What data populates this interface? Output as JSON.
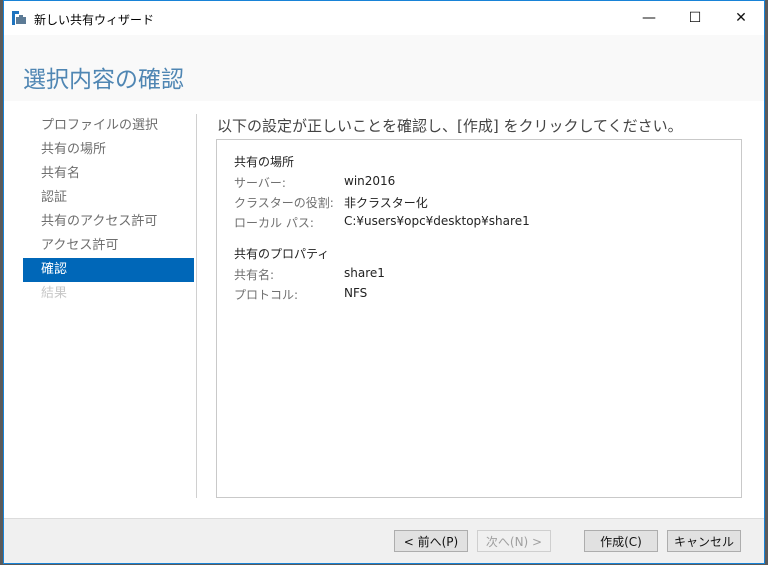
{
  "window": {
    "title": "新しい共有ウィザード",
    "minimize": "—",
    "maximize": "☐",
    "close": "✕"
  },
  "page_title": "選択内容の確認",
  "nav": [
    {
      "label": "プロファイルの選択",
      "state": "normal"
    },
    {
      "label": "共有の場所",
      "state": "normal"
    },
    {
      "label": "共有名",
      "state": "normal"
    },
    {
      "label": "認証",
      "state": "normal"
    },
    {
      "label": "共有のアクセス許可",
      "state": "normal"
    },
    {
      "label": "アクセス許可",
      "state": "normal"
    },
    {
      "label": "確認",
      "state": "selected"
    },
    {
      "label": "結果",
      "state": "disabled"
    }
  ],
  "heading": "以下の設定が正しいことを確認し、[作成] をクリックしてください。",
  "summary": {
    "location": {
      "title": "共有の場所",
      "rows": [
        {
          "key": "サーバー:",
          "value": "win2016"
        },
        {
          "key": "クラスターの役割:",
          "value": "非クラスター化"
        },
        {
          "key": "ローカル パス:",
          "value": "C:¥users¥opc¥desktop¥share1"
        }
      ]
    },
    "properties": {
      "title": "共有のプロパティ",
      "rows": [
        {
          "key": "共有名:",
          "value": "share1"
        },
        {
          "key": "プロトコル:",
          "value": "NFS"
        }
      ]
    }
  },
  "buttons": {
    "prev": "< 前へ(P)",
    "next": "次へ(N) >",
    "create": "作成(C)",
    "cancel": "キャンセル"
  },
  "colors": {
    "accent": "#0067b8",
    "title": "#4f86b3"
  }
}
